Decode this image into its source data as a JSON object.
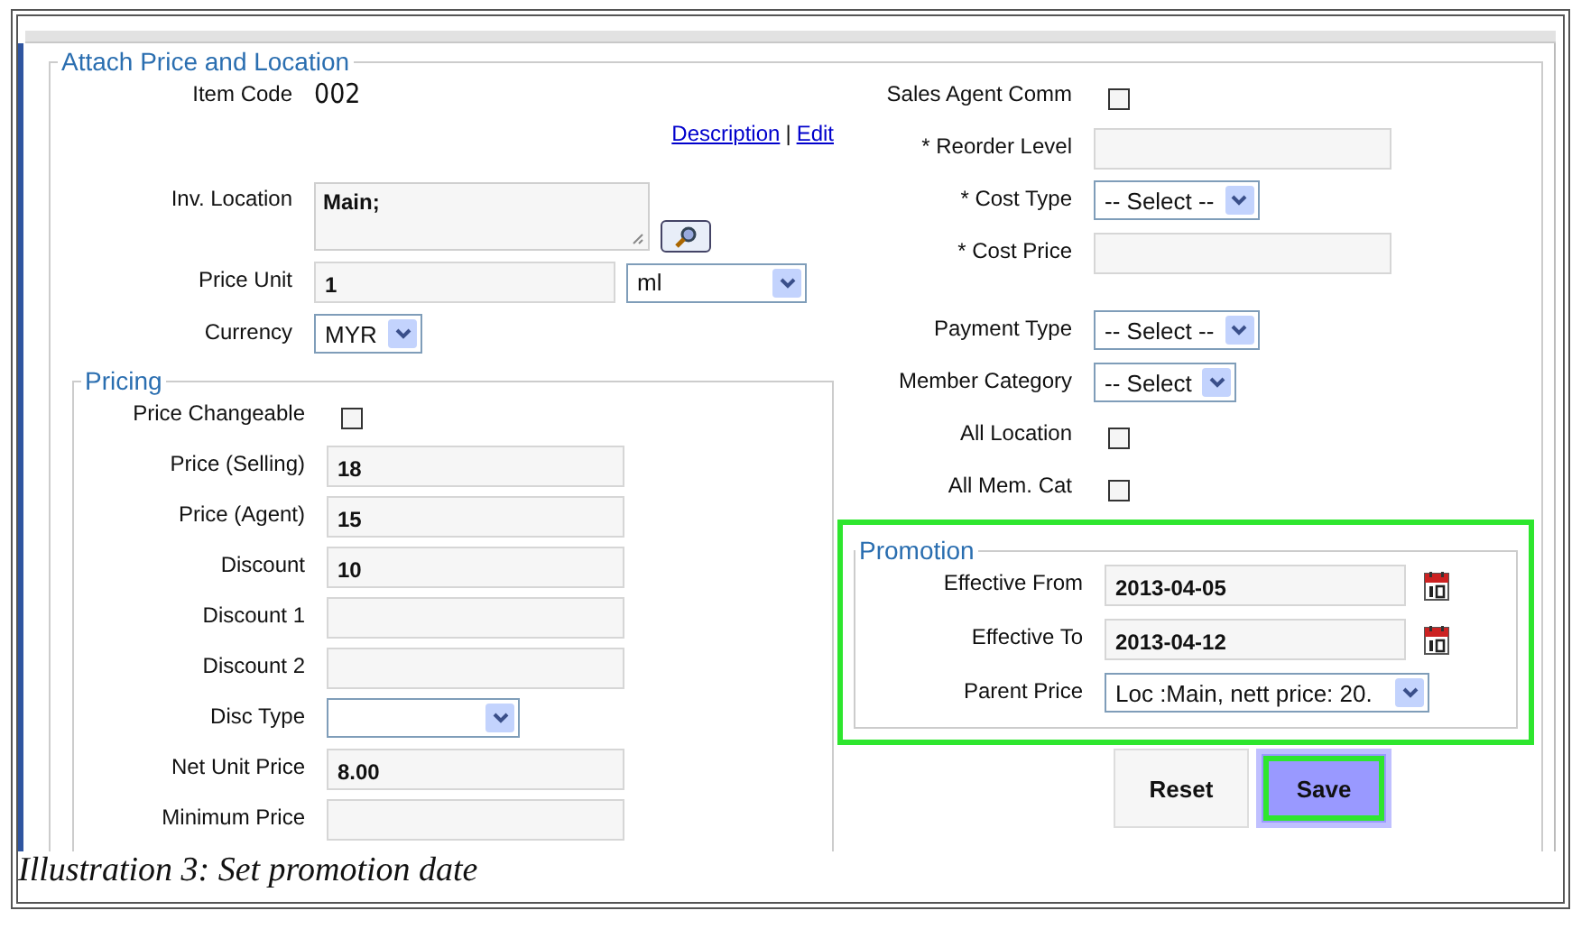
{
  "section_title": "Attach Price and Location",
  "left_fields": [
    {
      "kind": "static",
      "label": "Item Code",
      "value": "002"
    },
    {
      "kind": "links",
      "links": [
        "Description",
        "Edit"
      ],
      "separator": "|"
    },
    {
      "kind": "textarea",
      "label": "Inv. Location",
      "value": "Main;"
    },
    {
      "kind": "unit",
      "label": "Price Unit",
      "value": "1",
      "unit": "ml"
    },
    {
      "kind": "select",
      "label": "Currency",
      "value": "MYR"
    }
  ],
  "pricing": {
    "title": "Pricing",
    "fields": [
      {
        "kind": "checkbox",
        "label": "Price Changeable",
        "checked": false
      },
      {
        "kind": "text",
        "label": "Price (Selling)",
        "value": "18"
      },
      {
        "kind": "text",
        "label": "Price (Agent)",
        "value": "15"
      },
      {
        "kind": "text",
        "label": "Discount",
        "value": "10"
      },
      {
        "kind": "text",
        "label": "Discount 1"
      },
      {
        "kind": "text",
        "label": "Discount 2"
      },
      {
        "kind": "select",
        "label": "Disc Type"
      },
      {
        "kind": "text",
        "label": "Net Unit Price",
        "value": "8.00"
      },
      {
        "kind": "text",
        "label": "Minimum Price"
      }
    ]
  },
  "cost_fields": [
    {
      "kind": "checkbox",
      "label": "Sales Agent Comm",
      "checked": false
    },
    {
      "kind": "text",
      "label": "* Reorder Level"
    },
    {
      "kind": "select",
      "label": "* Cost Type",
      "value": "-- Select --"
    },
    {
      "kind": "text",
      "label": "* Cost Price"
    }
  ],
  "payment_fields": [
    {
      "kind": "select",
      "label": "Payment Type",
      "value": "-- Select --"
    },
    {
      "kind": "select",
      "label": "Member Category",
      "value": "-- Select"
    },
    {
      "kind": "checkbox",
      "label": "All Location",
      "checked": false
    },
    {
      "kind": "checkbox",
      "label": "All Mem. Cat",
      "checked": false
    }
  ],
  "promotion": {
    "title": "Promotion",
    "highlighted": true,
    "fields": [
      {
        "kind": "date",
        "label": "Effective From",
        "value": "2013-04-05"
      },
      {
        "kind": "date",
        "label": "Effective To",
        "value": "2013-04-12"
      },
      {
        "kind": "select",
        "label": "Parent Price",
        "value": "Loc :Main, nett price: 20."
      }
    ]
  },
  "buttons": [
    {
      "label": "Reset",
      "highlighted": false
    },
    {
      "label": "Save",
      "highlighted": true
    }
  ],
  "caption": "Illustration 3: Set promotion date"
}
